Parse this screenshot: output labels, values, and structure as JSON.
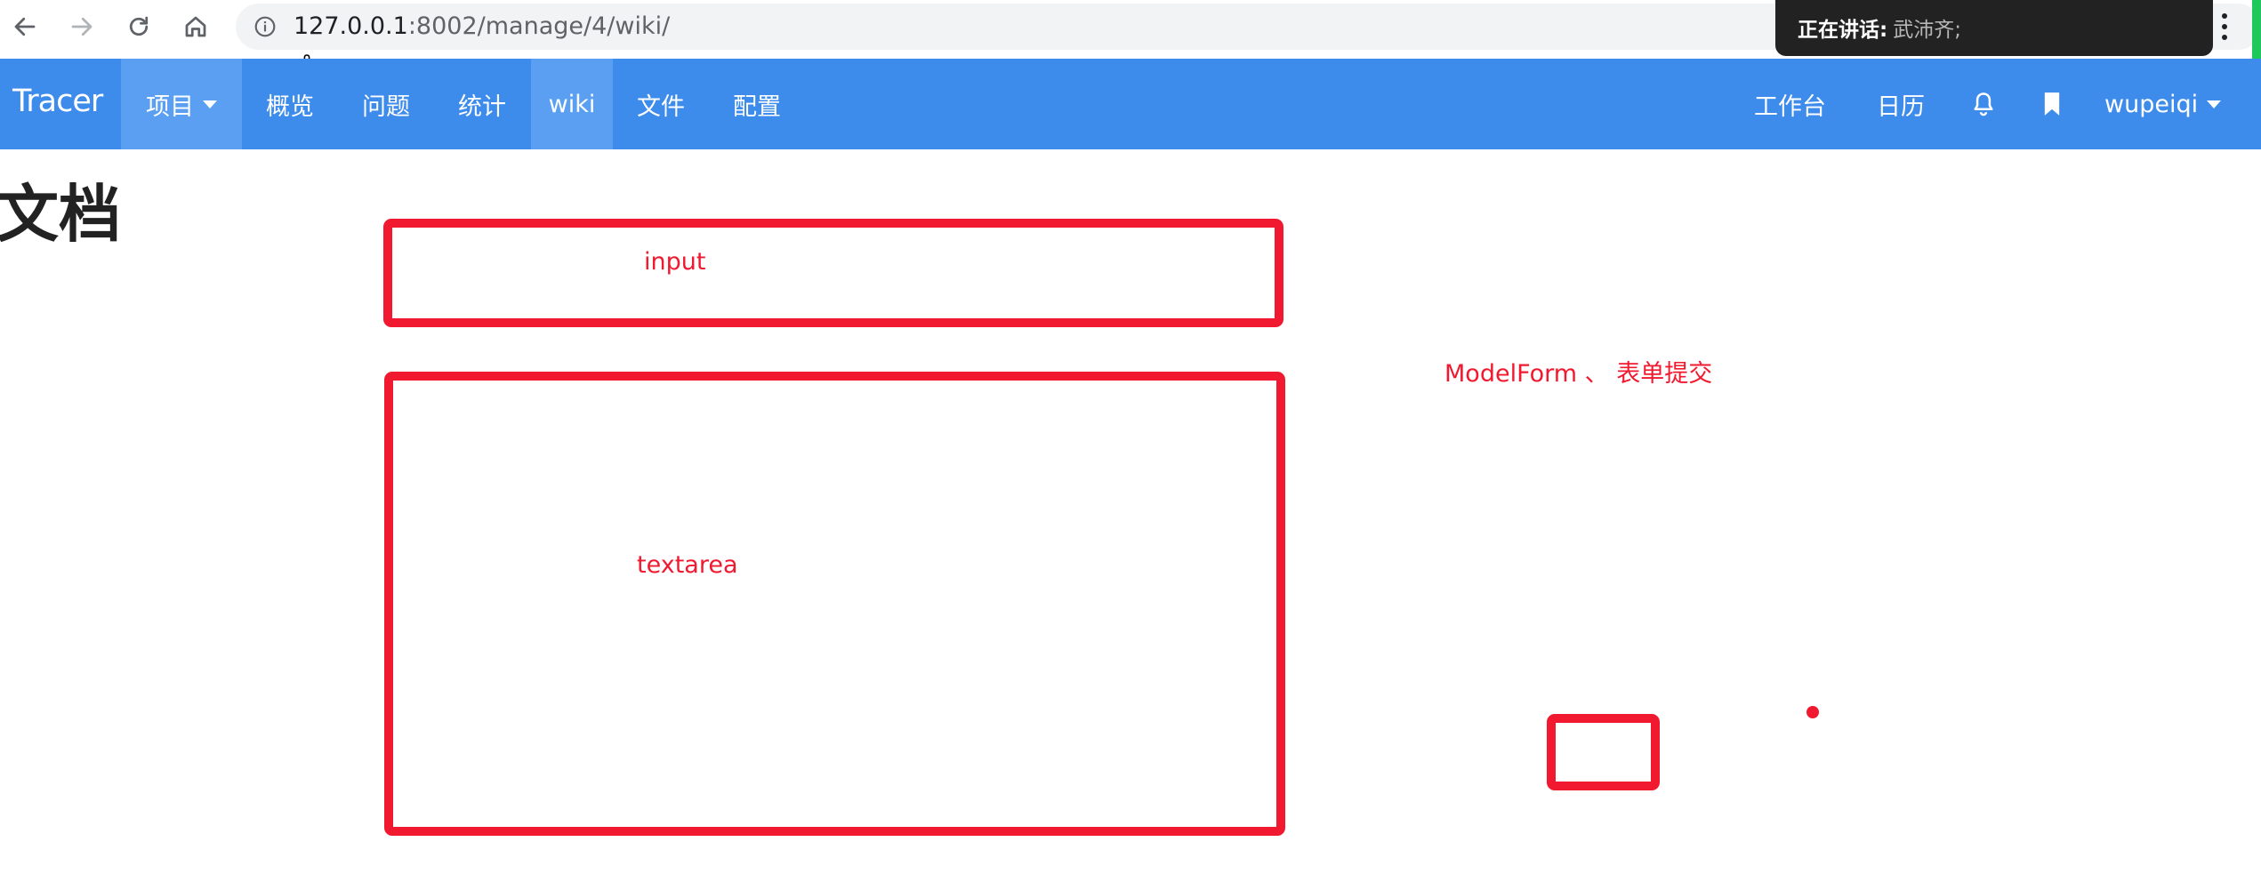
{
  "browser": {
    "url_host": "127.0.0.1",
    "url_path": ":8002/manage/4/wiki/",
    "icons": [
      "back-icon",
      "forward-icon",
      "reload-icon",
      "home-icon",
      "info-icon",
      "menu-kebab-icon"
    ]
  },
  "toast": {
    "label": "正在讲话:",
    "value": "武沛齐;"
  },
  "navbar": {
    "brand": "Tracer",
    "items": [
      {
        "label": "项目",
        "dropdown": true,
        "active": true
      },
      {
        "label": "概览",
        "active": false
      },
      {
        "label": "问题",
        "active": false
      },
      {
        "label": "统计",
        "active": false
      },
      {
        "label": "wiki",
        "active": true
      },
      {
        "label": "文件",
        "active": false
      },
      {
        "label": "配置",
        "active": false
      }
    ],
    "right": {
      "workbench": "工作台",
      "calendar": "日历",
      "icons": [
        "bell-icon",
        "bookmark-icon"
      ],
      "user": "wupeiqi"
    }
  },
  "page": {
    "title": "文档"
  },
  "annotations": {
    "input_label": "input",
    "textarea_label": "textarea",
    "note": "ModelForm 、 表单提交",
    "color": "#f0192f"
  },
  "colors": {
    "navbar": "#3d8beb",
    "navbar_active": "#5a9ff2",
    "annotation": "#f0192f"
  }
}
